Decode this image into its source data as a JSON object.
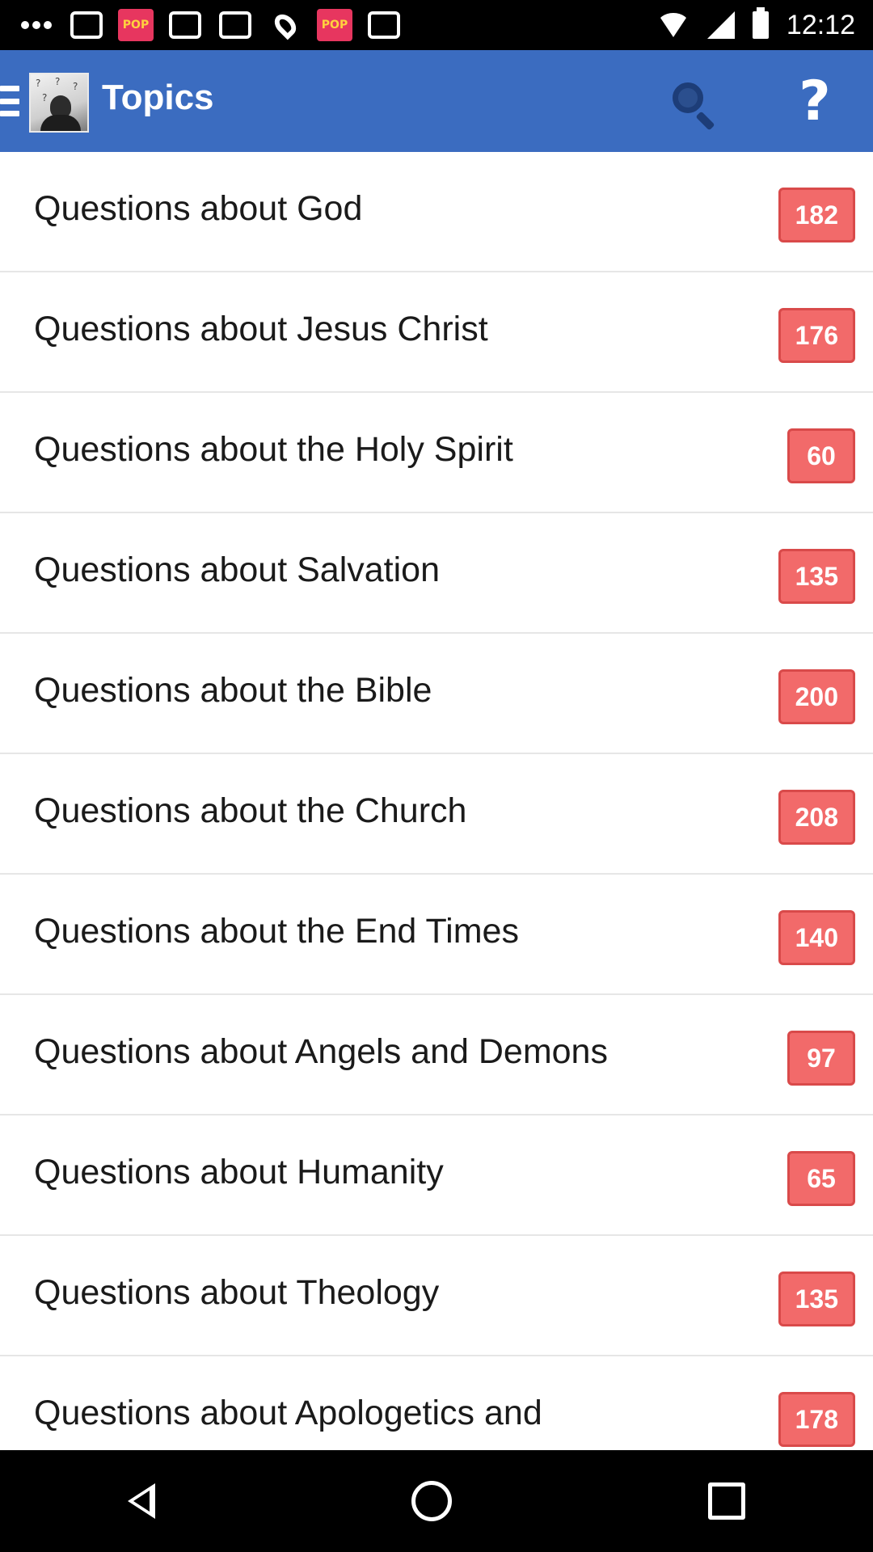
{
  "status_bar": {
    "time": "12:12",
    "icons": [
      "more-dots-icon",
      "image-icon",
      "pop-app-icon",
      "image-icon",
      "location-pin-icon",
      "pop-app-icon",
      "image-icon",
      "wifi-icon",
      "signal-icon",
      "battery-icon"
    ],
    "pop_label": "POP"
  },
  "app_bar": {
    "title": "Topics",
    "help_symbol": "?",
    "colors": {
      "background": "#3b6cc0",
      "badge": "#f26a6a"
    }
  },
  "topics": [
    {
      "label": "Questions about God",
      "count": "182"
    },
    {
      "label": "Questions about Jesus Christ",
      "count": "176"
    },
    {
      "label": "Questions about the Holy Spirit",
      "count": "60"
    },
    {
      "label": "Questions about Salvation",
      "count": "135"
    },
    {
      "label": "Questions about the Bible",
      "count": "200"
    },
    {
      "label": "Questions about the Church",
      "count": "208"
    },
    {
      "label": "Questions about the End Times",
      "count": "140"
    },
    {
      "label": "Questions about Angels and Demons",
      "count": "97"
    },
    {
      "label": "Questions about Humanity",
      "count": "65"
    },
    {
      "label": "Questions about Theology",
      "count": "135"
    },
    {
      "label": "Questions about Apologetics and",
      "count": "178"
    }
  ],
  "nav_bar": {
    "icons": [
      "back-icon",
      "home-icon",
      "recents-icon"
    ]
  }
}
